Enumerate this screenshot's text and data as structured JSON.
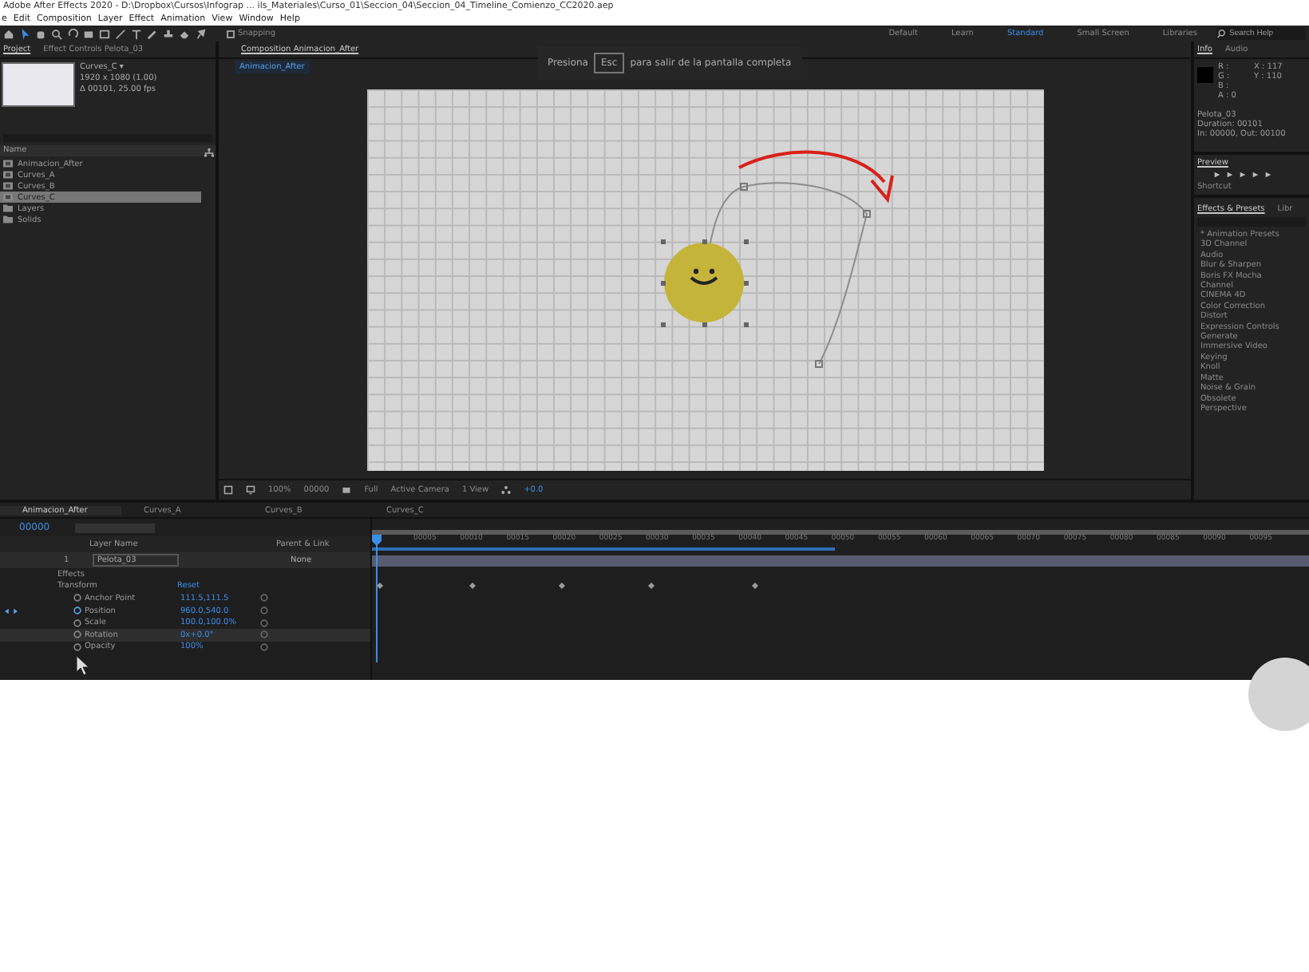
{
  "window": {
    "title": "Adobe After Effects 2020 - D:\\Dropbox\\Cursos\\Infograp ... ils_Materiales\\Curso_01\\Seccion_04\\Seccion_04_Timeline_Comienzo_CC2020.aep"
  },
  "menu": [
    "e",
    "Edit",
    "Composition",
    "Layer",
    "Effect",
    "Animation",
    "View",
    "Window",
    "Help"
  ],
  "toolbar": {
    "snapping": {
      "label": "Snapping",
      "checked": false
    }
  },
  "workspaces": [
    {
      "label": "Default",
      "selected": false
    },
    {
      "label": "Learn",
      "selected": false
    },
    {
      "label": "Standard",
      "selected": true
    },
    {
      "label": "Small Screen",
      "selected": false
    },
    {
      "label": "Libraries",
      "selected": false
    }
  ],
  "search_help": {
    "placeholder": "Search Help"
  },
  "fullscreen_notice": {
    "before": "Presiona",
    "key": "Esc",
    "after": "para salir de la pantalla completa"
  },
  "project_panel": {
    "tabs": [
      {
        "label": "Project",
        "selected": true
      },
      {
        "label": "Effect Controls Pelota_03",
        "selected": false
      }
    ],
    "info": {
      "name": "Curves_C ▾",
      "size": "1920 x 1080 (1.00)",
      "duration": "Δ 00101, 25.00 fps"
    },
    "column": "Name",
    "items": [
      {
        "name": "Animacion_After",
        "kind": "composition",
        "selected": false
      },
      {
        "name": "Curves_A",
        "kind": "composition",
        "selected": false
      },
      {
        "name": "Curves_B",
        "kind": "composition",
        "selected": false
      },
      {
        "name": "Curves_C",
        "kind": "composition",
        "selected": true
      },
      {
        "name": "Layers",
        "kind": "folder",
        "selected": false
      },
      {
        "name": "Solids",
        "kind": "folder",
        "selected": false
      }
    ]
  },
  "composition": {
    "tab": "Composition Animacion_After",
    "breadcrumb": "Animacion_After",
    "footer": {
      "zoom": "100%",
      "timecode": "00000",
      "resolution": "Full",
      "camera": "Active Camera",
      "views": "1 View",
      "exposure": "+0.0"
    }
  },
  "info_panel": {
    "tabs": [
      {
        "label": "Info",
        "selected": true
      },
      {
        "label": "Audio",
        "selected": false
      }
    ],
    "channels": [
      "R :",
      "G :",
      "B :",
      "A : 0"
    ],
    "coords": [
      "X : 117",
      "Y : 110"
    ],
    "details": [
      "Pelota_03",
      "Duration: 00101",
      "In: 00000, Out: 00100"
    ]
  },
  "preview_panel": {
    "title": "Preview",
    "shortcut": "Shortcut"
  },
  "effects_panel": {
    "tabs": [
      {
        "label": "Effects & Presets",
        "selected": true
      },
      {
        "label": "Libr",
        "selected": false
      }
    ],
    "items": [
      "* Animation Presets",
      "3D Channel",
      "Audio",
      "Blur & Sharpen",
      "Boris FX Mocha",
      "Channel",
      "CINEMA 4D",
      "Color Correction",
      "Distort",
      "Expression Controls",
      "Generate",
      "Immersive Video",
      "Keying",
      "Knoll",
      "Matte",
      "Noise & Grain",
      "Obsolete",
      "Perspective"
    ]
  },
  "timeline": {
    "tabs": [
      {
        "label": "Animacion_After",
        "selected": true
      },
      {
        "label": "Curves_A",
        "selected": false
      },
      {
        "label": "Curves_B",
        "selected": false
      },
      {
        "label": "Curves_C",
        "selected": false
      }
    ],
    "timecode": "00000",
    "columns": [
      "Layer Name",
      "Parent & Link"
    ],
    "ruler": [
      "00005",
      "00010",
      "00015",
      "00020",
      "00025",
      "00030",
      "00035",
      "00040",
      "00045",
      "00050",
      "00055",
      "00060",
      "00065",
      "00070",
      "00075",
      "00080",
      "00085",
      "00090",
      "00095"
    ],
    "layer": {
      "number": "1",
      "name": "Pelota_03",
      "parent": "None",
      "children": [
        {
          "name": "Effects"
        },
        {
          "name": "Transform",
          "value": "Reset",
          "children": [
            {
              "name": "Anchor Point",
              "value": "111.5,111.5",
              "animated": false,
              "selected": false
            },
            {
              "name": "Position",
              "value": "960.0,540.0",
              "animated": true,
              "selected": false
            },
            {
              "name": "Scale",
              "value": "100.0,100.0%",
              "animated": false,
              "selected": false
            },
            {
              "name": "Rotation",
              "value": "0x+0.0°",
              "animated": false,
              "selected": true
            },
            {
              "name": "Opacity",
              "value": "100%",
              "animated": false,
              "selected": false
            }
          ]
        }
      ]
    }
  }
}
